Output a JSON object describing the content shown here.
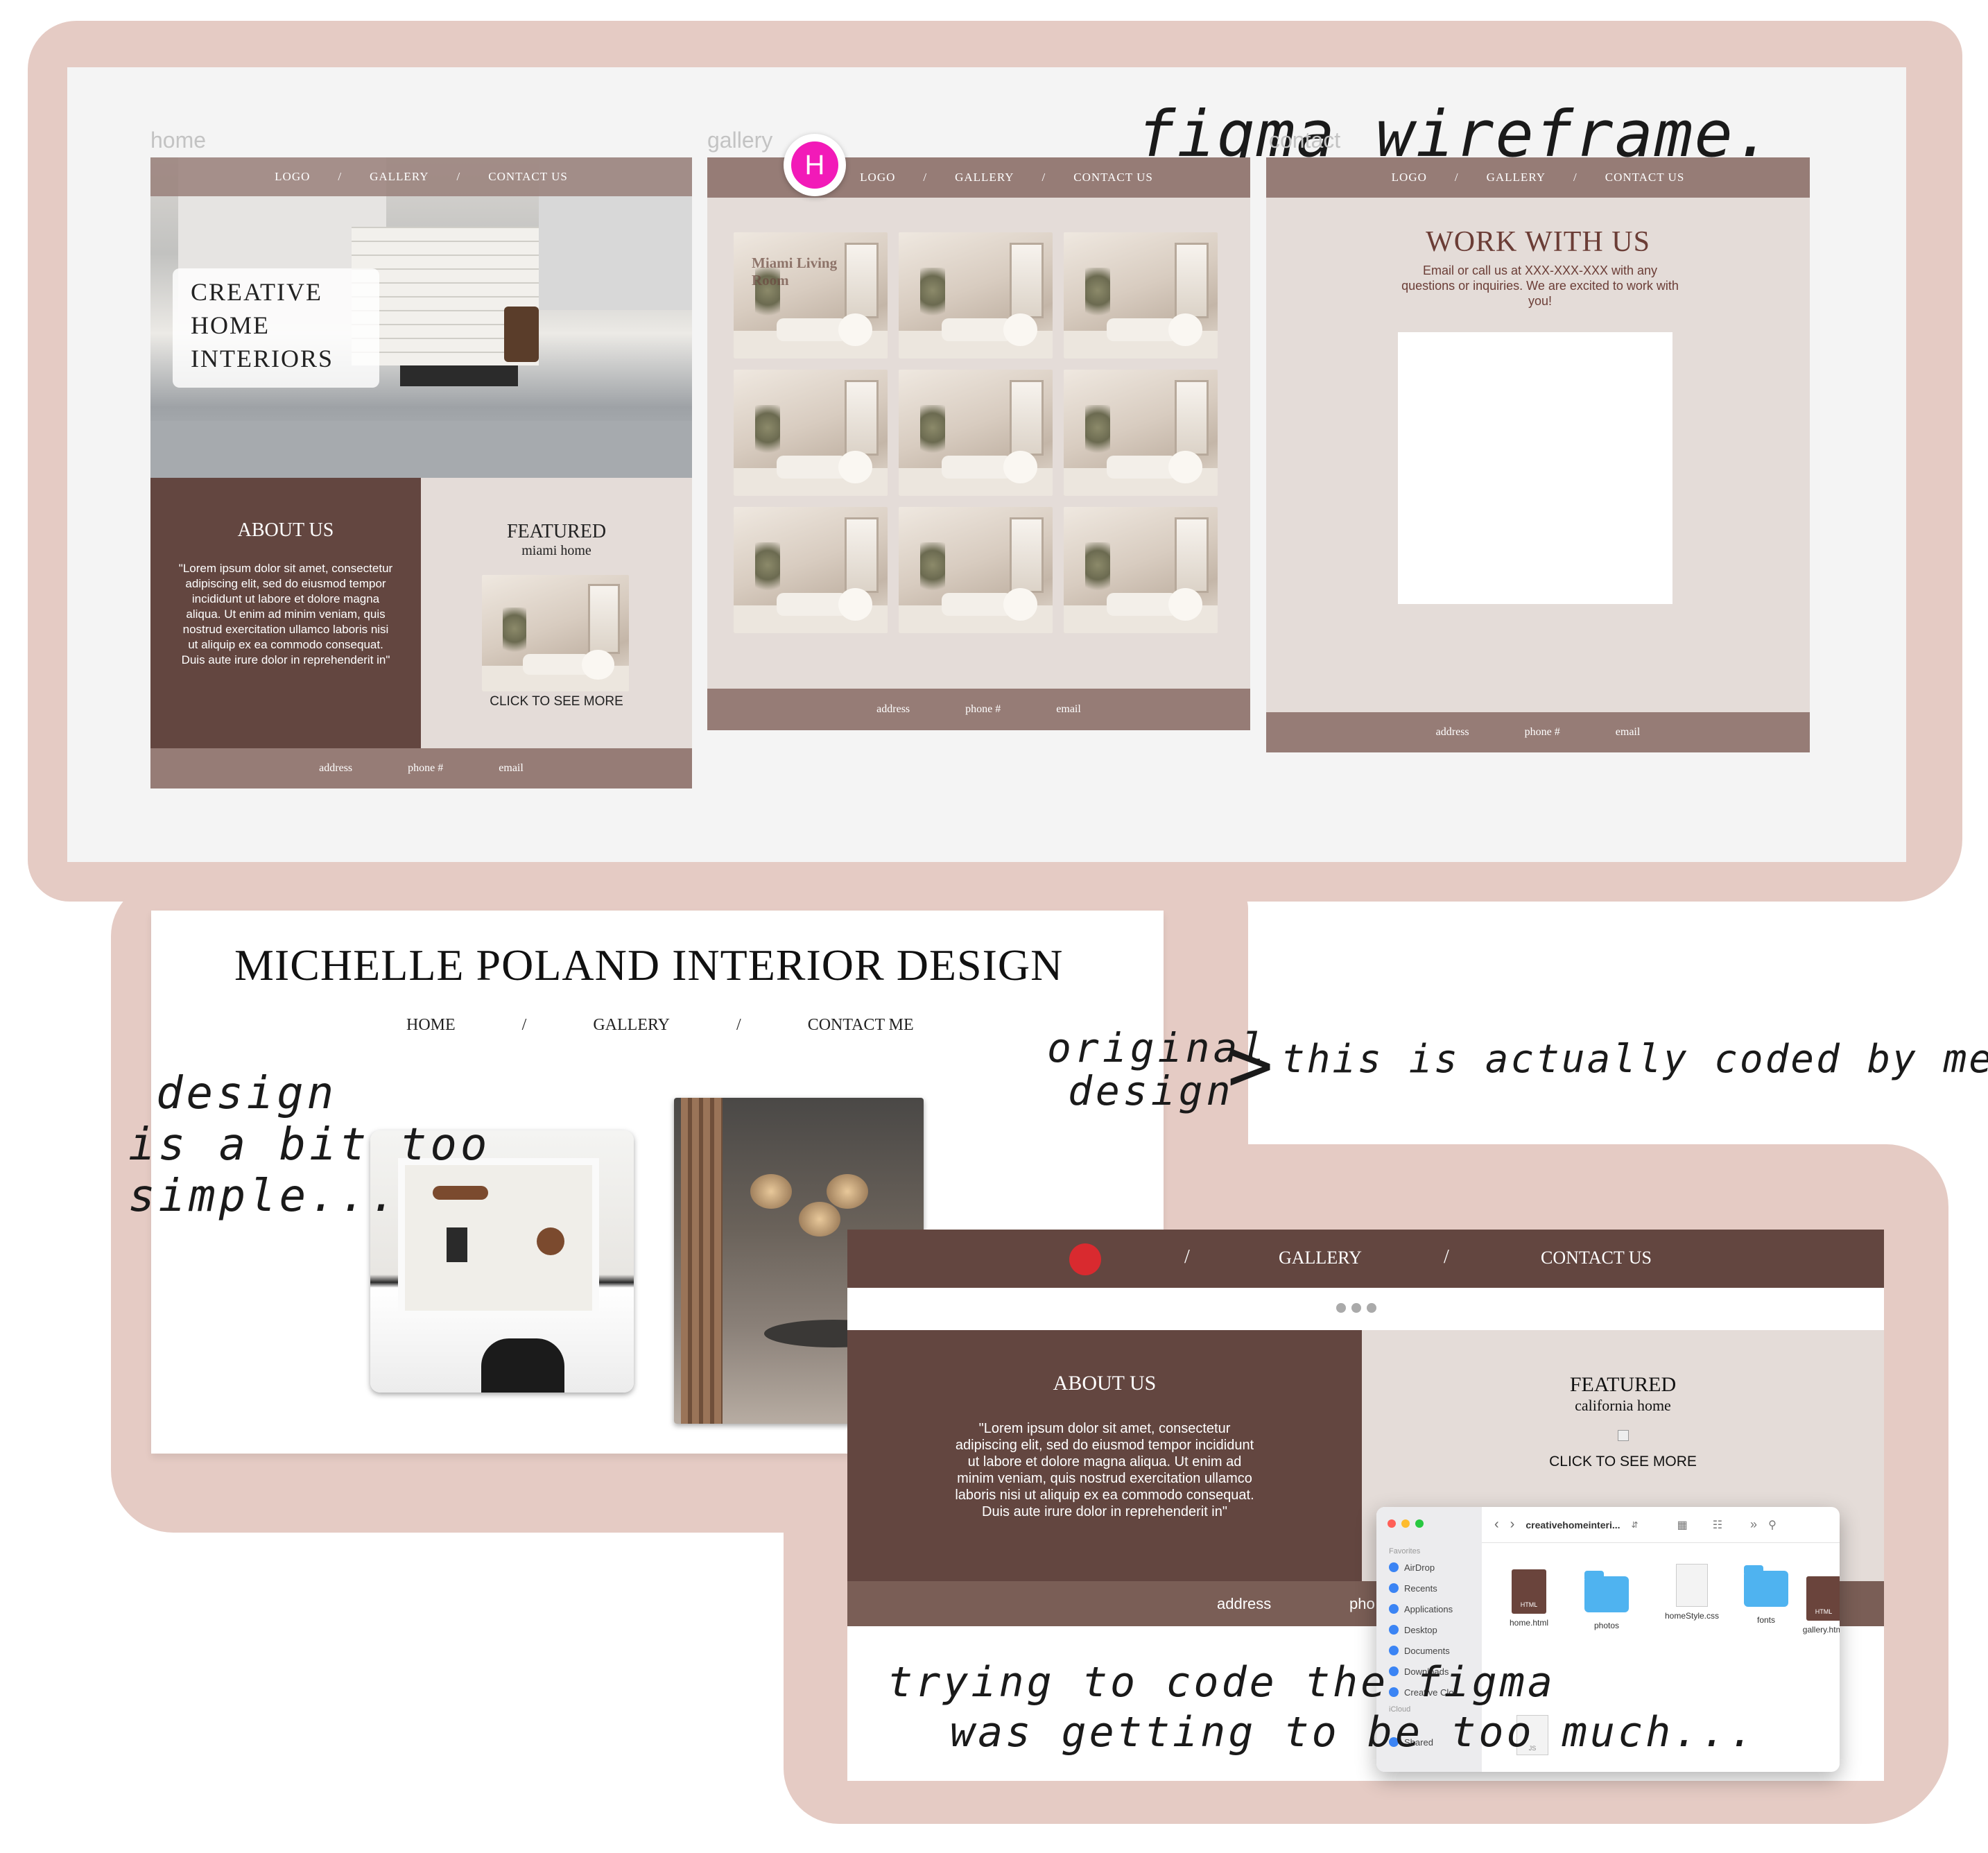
{
  "wireframe": {
    "annotation": "figma wireframe.",
    "pages": {
      "home": {
        "label": "home",
        "nav": [
          "LOGO",
          "/",
          "GALLERY",
          "/",
          "CONTACT US"
        ],
        "hero_title_lines": [
          "CREATIVE",
          "HOME",
          "INTERIORS"
        ],
        "about_title": "ABOUT US",
        "about_text": "\"Lorem ipsum dolor sit amet, consectetur adipiscing elit, sed do eiusmod tempor incididunt ut labore et dolore magna aliqua. Ut enim ad minim veniam, quis nostrud exercitation ullamco laboris nisi ut aliquip ex ea commodo consequat. Duis aute irure dolor in reprehenderit in\"",
        "featured_title": "FEATURED",
        "featured_subtitle": "miami home",
        "featured_cta": "CLICK TO SEE MORE",
        "footer": [
          "address",
          "phone #",
          "email"
        ]
      },
      "gallery": {
        "label": "gallery",
        "avatar_letter": "H",
        "nav": [
          "LOGO",
          "/",
          "GALLERY",
          "/",
          "CONTACT US"
        ],
        "first_tile_caption": "Miami Living Room",
        "footer": [
          "address",
          "phone #",
          "email"
        ]
      },
      "contact": {
        "label": "contact",
        "nav": [
          "LOGO",
          "/",
          "GALLERY",
          "/",
          "CONTACT US"
        ],
        "title": "WORK WITH US",
        "text": "Email or call us at XXX-XXX-XXX with any questions or inquiries. We are excited to work with you!",
        "footer": [
          "address",
          "phone #",
          "email"
        ]
      }
    }
  },
  "original": {
    "title": "MICHELLE POLAND INTERIOR DESIGN",
    "nav": [
      "HOME",
      "/",
      "GALLERY",
      "/",
      "CONTACT ME"
    ],
    "annotation_left": [
      "design",
      "is a bit too",
      "simple..."
    ],
    "annotation_right_a": [
      "original",
      "design"
    ],
    "annotation_right_b": "this is actually coded by me!"
  },
  "coded": {
    "nav": [
      "/",
      "GALLERY",
      "/",
      "CONTACT US"
    ],
    "about_title": "ABOUT US",
    "about_text": "\"Lorem ipsum dolor sit amet, consectetur adipiscing elit, sed do eiusmod tempor incididunt ut labore et dolore magna aliqua. Ut enim ad minim veniam, quis nostrud exercitation ullamco laboris nisi ut aliquip ex ea commodo consequat. Duis aute irure dolor in reprehenderit in\"",
    "featured_title": "FEATURED",
    "featured_subtitle": "california home",
    "featured_cta": "CLICK TO SEE MORE",
    "footer_address": "address",
    "footer_phone": "pho",
    "annotation": [
      "trying to code the figma",
      "was getting to be too much..."
    ]
  },
  "finder": {
    "path": "creativehomeinteri...",
    "sidebar_heading": "Favorites",
    "sidebar": [
      "AirDrop",
      "Recents",
      "Applications",
      "Desktop",
      "Documents",
      "Downloads",
      "Creative Clo..."
    ],
    "icloud_heading": "iCloud",
    "shared": "Shared",
    "files": [
      {
        "name": "home.html",
        "kind": "html"
      },
      {
        "name": "photos",
        "kind": "folder"
      },
      {
        "name": "homeStyle.css",
        "kind": "css"
      },
      {
        "name": "fonts",
        "kind": "folder"
      },
      {
        "name": "gallery.html",
        "kind": "html"
      }
    ],
    "file_badge": "HTML",
    "js_badge": "JS"
  },
  "colors": {
    "blob": "#e5cbc4",
    "nav_mauve": "#967c76",
    "brown_dark": "#634640",
    "beige_panel": "#e4dcd8",
    "title_brown": "#6b3d36"
  }
}
